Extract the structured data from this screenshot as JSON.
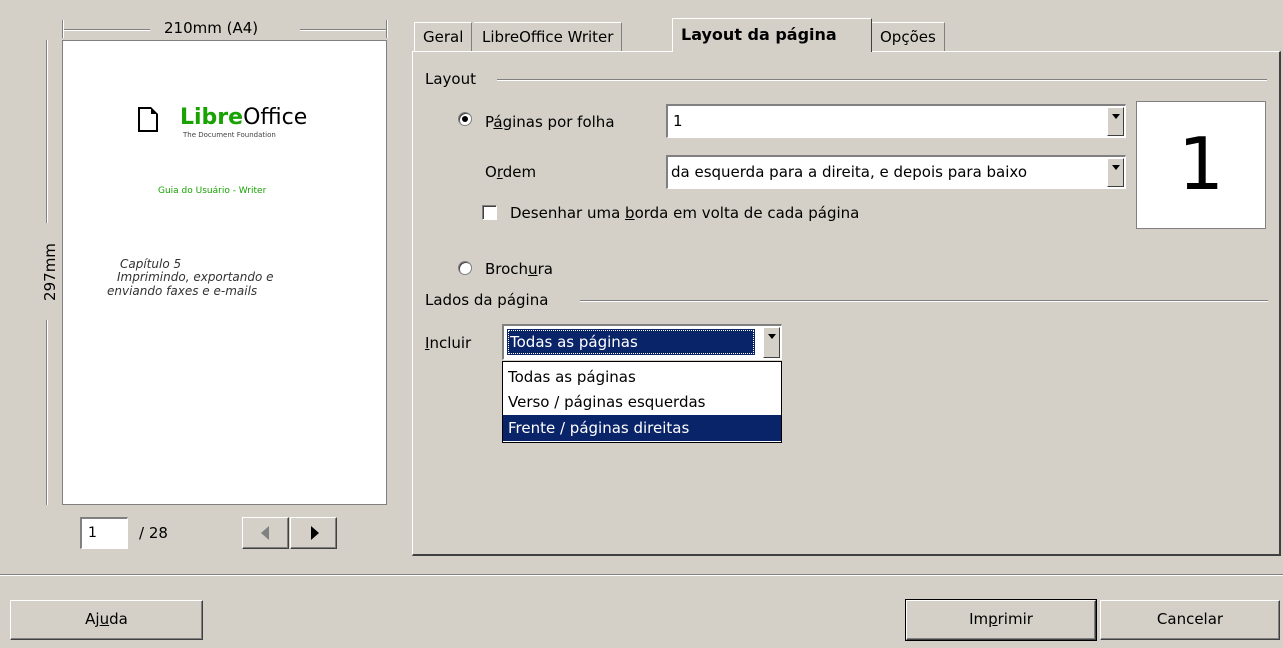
{
  "preview": {
    "width_label": "210mm (A4)",
    "height_label": "297mm",
    "logo_main": "Libre",
    "logo_office": "Office",
    "logo_tagline": "The Document Foundation",
    "guide_title": "Guia do Usuário - Writer",
    "chapter_title": "Capítulo 5",
    "chapter_sub1": "Imprimindo, exportando e",
    "chapter_sub2": "enviando faxes e e-mails",
    "page_input": "1",
    "page_total": "/ 28"
  },
  "tabs": [
    {
      "label": "Geral"
    },
    {
      "label": "LibreOffice Writer"
    },
    {
      "label": "Layout da página"
    },
    {
      "label": "Opções"
    }
  ],
  "layout": {
    "group_label": "Layout",
    "pages_per_sheet_pre": "P",
    "pages_per_sheet_u": "á",
    "pages_per_sheet_post": "ginas por folha",
    "pages_per_sheet_value": "1",
    "order_pre": "O",
    "order_u": "r",
    "order_post": "dem",
    "order_value": "da esquerda para a direita, e depois para baixo",
    "border_pre": "Desenhar uma ",
    "border_u": "b",
    "border_post": "orda em volta de cada página",
    "brochure_pre": "Broch",
    "brochure_u": "u",
    "brochure_post": "ra",
    "preview_number": "1"
  },
  "sides": {
    "group_label": "Lados da página",
    "include_u": "I",
    "include_post": "ncluir",
    "include_value": "Todas as páginas",
    "options": [
      "Todas as páginas",
      "Verso / páginas esquerdas",
      "Frente / páginas direitas"
    ],
    "highlighted_index": 2
  },
  "footer": {
    "help_pre": "Aj",
    "help_u": "u",
    "help_post": "da",
    "print_pre": "Im",
    "print_u": "p",
    "print_post": "rimir",
    "cancel": "Cancelar"
  },
  "colors": {
    "background": "#d4d0c8",
    "selection": "#0a246a",
    "logo_green": "#18a303"
  }
}
